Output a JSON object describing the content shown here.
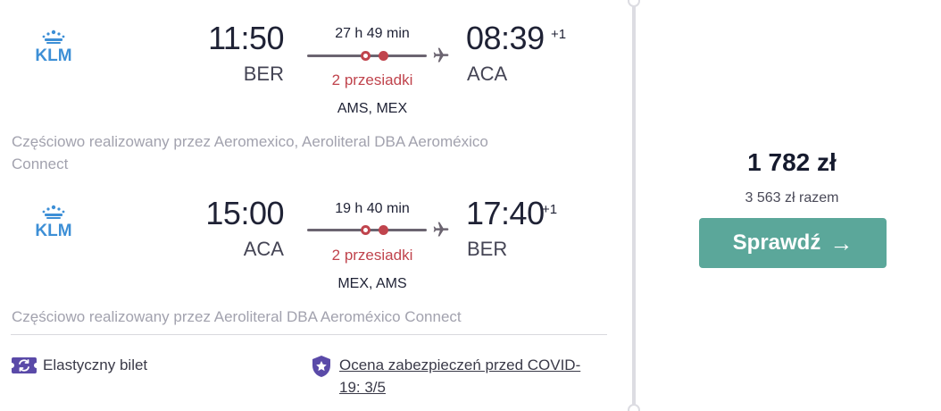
{
  "outbound": {
    "airline_logo_text": "KLM",
    "dep_time": "11:50",
    "dep_code": "BER",
    "duration": "27 h 49 min",
    "stops_text": "2 przesiadki",
    "via": "AMS, MEX",
    "arr_time": "08:39",
    "arr_plus": "+1",
    "arr_code": "ACA",
    "operated_line1": "Częściowo realizowany przez Aeromexico, Aeroliteral DBA Aeroméxico",
    "operated_line2": "Connect"
  },
  "inbound": {
    "airline_logo_text": "KLM",
    "dep_time": "15:00",
    "dep_code": "ACA",
    "duration": "19 h 40 min",
    "stops_text": "2 przesiadki",
    "via": "MEX, AMS",
    "arr_time": "17:40",
    "arr_plus": "+1",
    "arr_code": "BER",
    "operated_line1": "Częściowo realizowany przez Aeroliteral DBA Aeroméxico Connect"
  },
  "features": {
    "flexible_ticket": "Elastyczny bilet",
    "covid_line1": "Ocena zabezpieczeń przed COVID-",
    "covid_line2": "19: 3/5"
  },
  "pricing": {
    "price": "1 782 zł",
    "total": "3 563 zł razem",
    "cta_label": "Sprawdź",
    "cta_arrow": "→"
  },
  "colors": {
    "accent": "#5ba79a",
    "stops_red": "#c0444d",
    "klm_blue": "#3d8fd6",
    "badge_purple": "#5a4aa8"
  },
  "icons": {
    "airline_logo": "klm-crown-logo",
    "plane": "plane-icon",
    "flexible": "flexible-ticket-icon",
    "covid": "shield-star-icon",
    "cta": "arrow-right-icon"
  }
}
